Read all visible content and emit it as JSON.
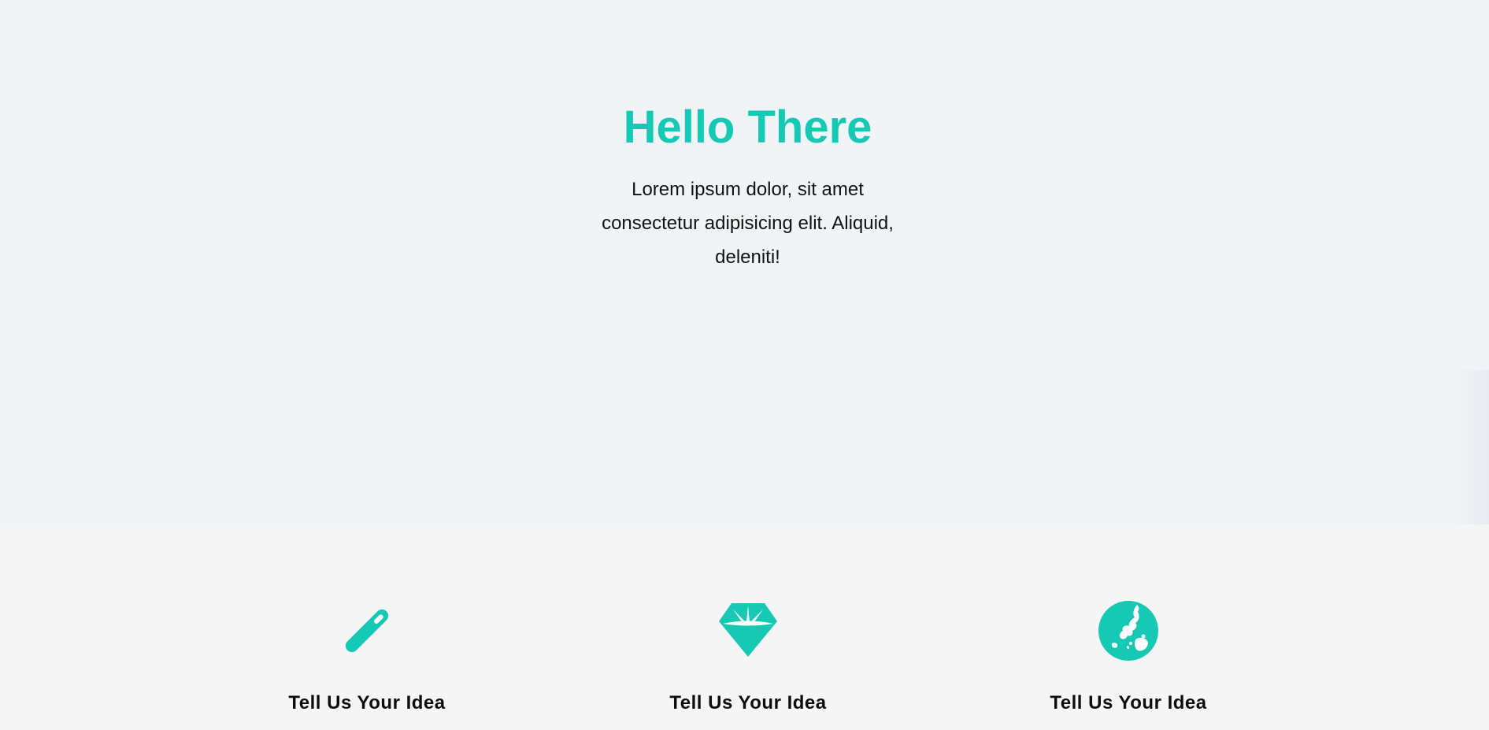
{
  "hero": {
    "title": "Hello There",
    "text": "Lorem ipsum dolor, sit amet consectetur adipisicing elit. Aliquid, deleniti!"
  },
  "features": [
    {
      "icon": "magic-wand-icon",
      "title": "Tell Us Your Idea"
    },
    {
      "icon": "gem-icon",
      "title": "Tell Us Your Idea"
    },
    {
      "icon": "globe-icon",
      "title": "Tell Us Your Idea"
    }
  ],
  "colors": {
    "accent": "#16c9b4",
    "hero_background": "#f1f4f7",
    "features_background": "#f5f5f5"
  }
}
